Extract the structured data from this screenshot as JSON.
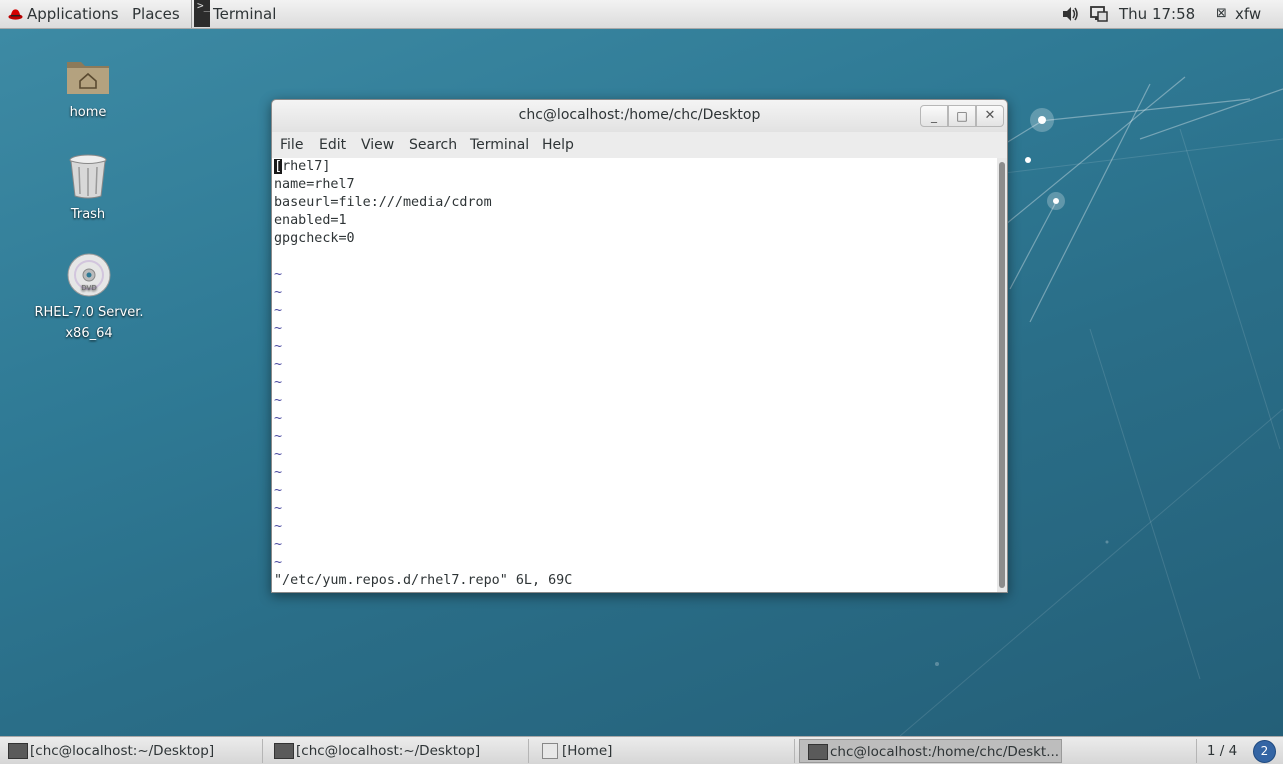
{
  "top_bar": {
    "applications": "Applications",
    "places": "Places",
    "active_app": "Terminal",
    "clock": "Thu 17:58",
    "user": "xfw"
  },
  "desktop_icons": [
    {
      "label": "home"
    },
    {
      "label": "Trash"
    },
    {
      "label_line1": "RHEL-7.0 Server.",
      "label_line2": "x86_64",
      "badge": "DVD"
    }
  ],
  "terminal": {
    "title": "chc@localhost:/home/chc/Desktop",
    "menu": [
      "File",
      "Edit",
      "View",
      "Search",
      "Terminal",
      "Help"
    ],
    "cursor_char": "[",
    "first_line_rest": "rhel7]",
    "lines": [
      "name=rhel7",
      "baseurl=file:///media/cdrom",
      "enabled=1",
      "gpgcheck=0"
    ],
    "tilde": "~",
    "status_line": "\"/etc/yum.repos.d/rhel7.repo\" 6L, 69C"
  },
  "taskbar": {
    "tasks": [
      {
        "label": "[chc@localhost:~/Desktop]"
      },
      {
        "label": "[chc@localhost:~/Desktop]"
      },
      {
        "label": "[Home]"
      },
      {
        "label": "chc@localhost:/home/chc/Deskt..."
      }
    ],
    "workspace": "1 / 4",
    "notifications": "2"
  },
  "colors": {
    "desktop_bg": "#2f7a95",
    "panel_bg": "#dcdcdc",
    "terminal_bg": "#ffffff",
    "tilde_color": "#4a4aa0"
  }
}
